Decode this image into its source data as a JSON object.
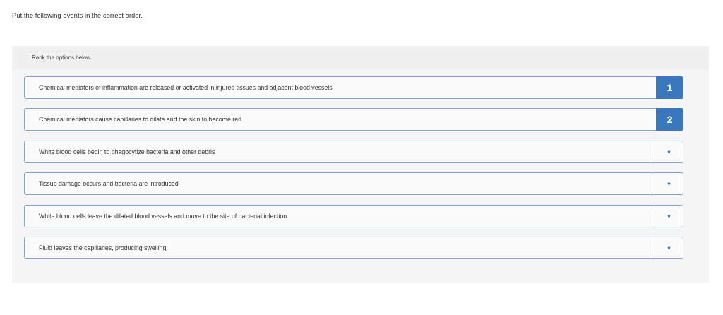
{
  "prompt": "Put the following events in the correct order.",
  "instruction": "Rank the options below.",
  "items": [
    {
      "text": "Chemical mediators of inflammation are released or activated in injured tissues and adjacent blood vessels",
      "rank": "1"
    },
    {
      "text": "Chemical mediators cause capillaries to dilate and the skin to become red",
      "rank": "2"
    },
    {
      "text": "White blood cells begin to phagocytize bacteria and other debris",
      "rank": "▾"
    },
    {
      "text": "Tissue damage occurs and bacteria are introduced",
      "rank": "▾"
    },
    {
      "text": "White blood cells leave the dilated blood vessels and move to the site of bacterial infection",
      "rank": "▾"
    },
    {
      "text": "Fluid leaves the capillaries, producing swelling",
      "rank": "▾"
    }
  ],
  "colors": {
    "accent": "#3a78bd"
  }
}
